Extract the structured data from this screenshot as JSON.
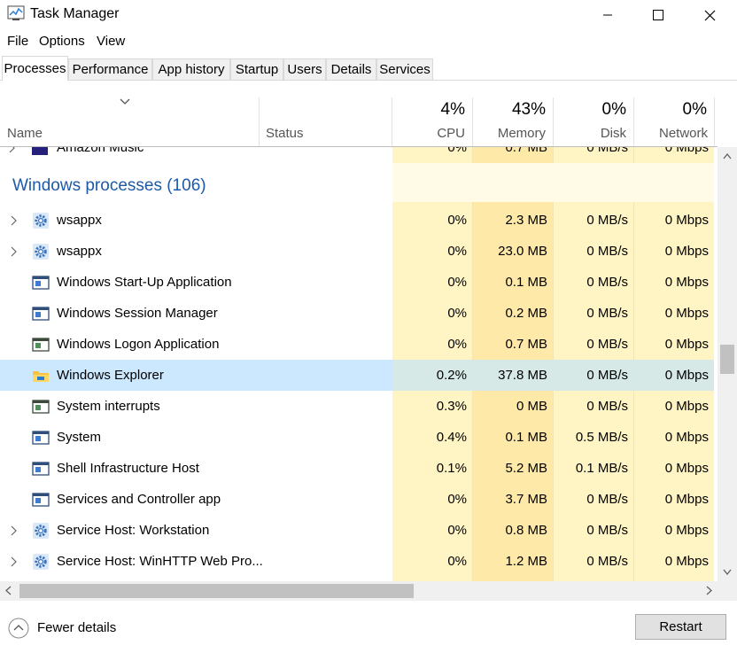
{
  "window": {
    "title": "Task Manager"
  },
  "menu": [
    "File",
    "Options",
    "View"
  ],
  "tabs": [
    "Processes",
    "Performance",
    "App history",
    "Startup",
    "Users",
    "Details",
    "Services"
  ],
  "columns": {
    "name": "Name",
    "status": "Status",
    "cpu": {
      "pct": "4%",
      "label": "CPU"
    },
    "memory": {
      "pct": "43%",
      "label": "Memory"
    },
    "disk": {
      "pct": "0%",
      "label": "Disk"
    },
    "network": {
      "pct": "0%",
      "label": "Network"
    }
  },
  "partial_row": {
    "name": "Amazon Music",
    "cpu": "0%",
    "memory": "0.7 MB",
    "disk": "0 MB/s",
    "network": "0 Mbps"
  },
  "group": {
    "label": "Windows processes (106)"
  },
  "processes": [
    {
      "name": "wsappx",
      "expandable": true,
      "icon": "gear-icon",
      "cpu": "0%",
      "memory": "2.3 MB",
      "disk": "0 MB/s",
      "network": "0 Mbps"
    },
    {
      "name": "wsappx",
      "expandable": true,
      "icon": "gear-icon",
      "cpu": "0%",
      "memory": "23.0 MB",
      "disk": "0 MB/s",
      "network": "0 Mbps"
    },
    {
      "name": "Windows Start-Up Application",
      "expandable": false,
      "icon": "app-window-icon",
      "cpu": "0%",
      "memory": "0.1 MB",
      "disk": "0 MB/s",
      "network": "0 Mbps"
    },
    {
      "name": "Windows Session Manager",
      "expandable": false,
      "icon": "app-window-icon",
      "cpu": "0%",
      "memory": "0.2 MB",
      "disk": "0 MB/s",
      "network": "0 Mbps"
    },
    {
      "name": "Windows Logon Application",
      "expandable": false,
      "icon": "logon-window-icon",
      "cpu": "0%",
      "memory": "0.7 MB",
      "disk": "0 MB/s",
      "network": "0 Mbps"
    },
    {
      "name": "Windows Explorer",
      "expandable": false,
      "icon": "folder-icon",
      "selected": true,
      "cpu": "0.2%",
      "memory": "37.8 MB",
      "disk": "0 MB/s",
      "network": "0 Mbps"
    },
    {
      "name": "System interrupts",
      "expandable": false,
      "icon": "logon-window-icon",
      "cpu": "0.3%",
      "memory": "0 MB",
      "disk": "0 MB/s",
      "network": "0 Mbps"
    },
    {
      "name": "System",
      "expandable": false,
      "icon": "app-window-icon",
      "cpu": "0.4%",
      "memory": "0.1 MB",
      "disk": "0.5 MB/s",
      "network": "0 Mbps"
    },
    {
      "name": "Shell Infrastructure Host",
      "expandable": false,
      "icon": "app-window-icon",
      "cpu": "0.1%",
      "memory": "5.2 MB",
      "disk": "0.1 MB/s",
      "network": "0 Mbps"
    },
    {
      "name": "Services and Controller app",
      "expandable": false,
      "icon": "app-window-icon",
      "cpu": "0%",
      "memory": "3.7 MB",
      "disk": "0 MB/s",
      "network": "0 Mbps"
    },
    {
      "name": "Service Host: Workstation",
      "expandable": true,
      "icon": "gear-icon",
      "cpu": "0%",
      "memory": "0.8 MB",
      "disk": "0 MB/s",
      "network": "0 Mbps"
    },
    {
      "name": "Service Host: WinHTTP Web Pro...",
      "expandable": true,
      "icon": "gear-icon",
      "cpu": "0%",
      "memory": "1.2 MB",
      "disk": "0 MB/s",
      "network": "0 Mbps"
    }
  ],
  "footer": {
    "fewer_details": "Fewer details",
    "restart": "Restart"
  },
  "colors": {
    "heat_light": "#fff4c4",
    "heat_mid": "#ffe9a8",
    "group_bg": "#fffbe6",
    "selected": "#cce8ff",
    "accent_text": "#1c5aa8"
  }
}
